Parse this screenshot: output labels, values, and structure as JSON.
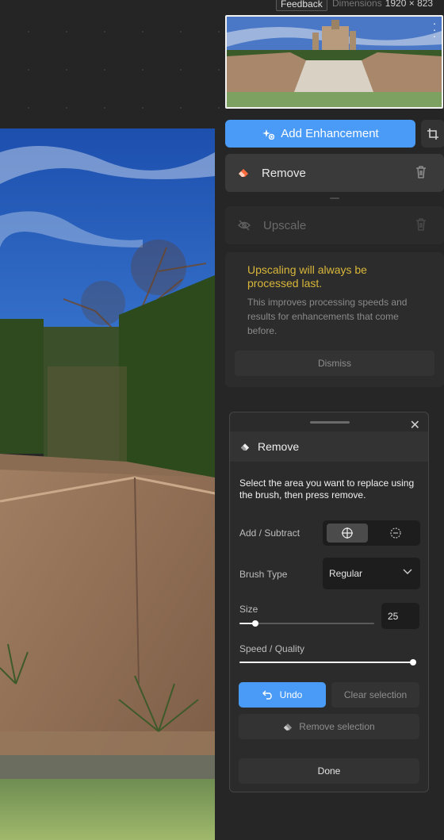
{
  "topbar": {
    "feedback_label": "Feedback",
    "dimensions_label": "Dimensions",
    "dimensions_value": "1920 × 823"
  },
  "enhancements": {
    "add_label": "Add Enhancement",
    "items": [
      {
        "label": "Remove",
        "icon": "eraser-icon",
        "icon_color": "#ff6a3d",
        "active": true
      },
      {
        "label": "Upscale",
        "icon": "eye-off-icon",
        "active": false
      }
    ]
  },
  "notice": {
    "title": "Upscaling will always be processed last.",
    "body": "This improves processing speeds and results for enhancements that come before.",
    "dismiss_label": "Dismiss"
  },
  "remove_tool": {
    "title": "Remove",
    "description": "Select the area you want to replace using the brush, then press remove.",
    "add_subtract_label": "Add / Subtract",
    "add_subtract_selected": "add",
    "brush_type_label": "Brush Type",
    "brush_type_value": "Regular",
    "size_label": "Size",
    "size_value": "25",
    "size_fraction": 0.12,
    "speed_quality_label": "Speed / Quality",
    "speed_quality_fraction": 1.0,
    "undo_label": "Undo",
    "clear_selection_label": "Clear selection",
    "remove_selection_label": "Remove selection",
    "done_label": "Done"
  },
  "colors": {
    "accent": "#4a9bf7",
    "notice_title": "#d9b73a",
    "background": "#262626"
  }
}
